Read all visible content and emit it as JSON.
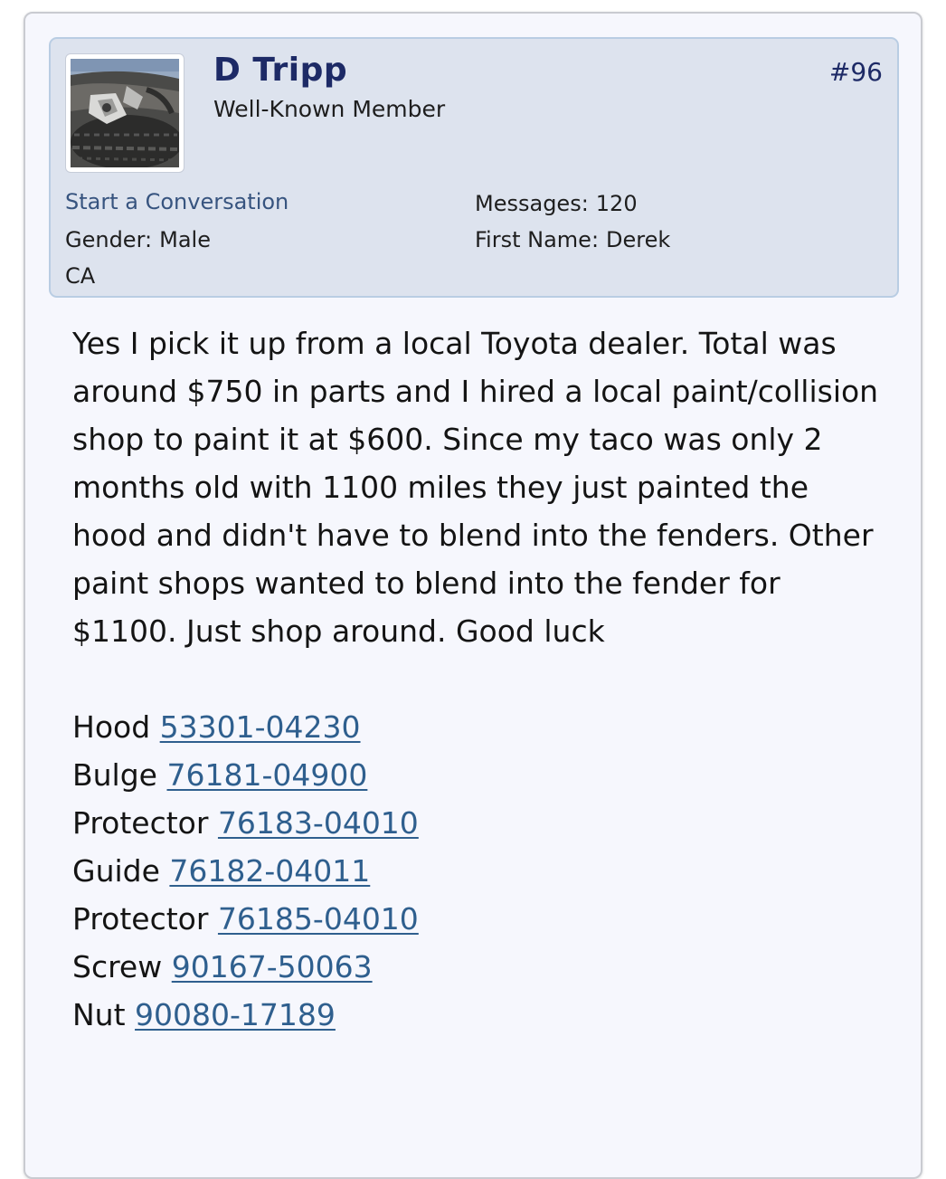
{
  "post": {
    "number": "#96",
    "author": {
      "name": "D Tripp",
      "title": "Well-Known Member",
      "avatar_icon": "truck-wheel-avatar",
      "start_conversation_label": "Start a Conversation",
      "gender_label": "Gender:",
      "gender_value": "Male",
      "location": "CA",
      "messages_label": "Messages:",
      "messages_value": "120",
      "first_name_label": "First Name:",
      "first_name_value": "Derek"
    },
    "body_text": "Yes I pick it up from a local Toyota dealer. Total was around $750 in parts and I hired a local paint/collision shop to paint it at $600. Since my taco was only 2 months old with 1100 miles they just painted the hood and didn't have to blend into the fenders. Other paint shops wanted to blend into the fender for $1100. Just shop around. Good luck",
    "parts": [
      {
        "name": "Hood",
        "number": "53301-04230"
      },
      {
        "name": "Bulge",
        "number": "76181-04900"
      },
      {
        "name": "Protector",
        "number": "76183-04010"
      },
      {
        "name": "Guide",
        "number": "76182-04011"
      },
      {
        "name": "Protector",
        "number": "76185-04010"
      },
      {
        "name": "Screw",
        "number": "90167-50063"
      },
      {
        "name": "Nut",
        "number": "90080-17189"
      }
    ]
  },
  "colors": {
    "card_bg": "#f6f7fd",
    "user_box_bg": "#dde3ee",
    "username": "#1d2a66",
    "link": "#2f5f8e"
  }
}
